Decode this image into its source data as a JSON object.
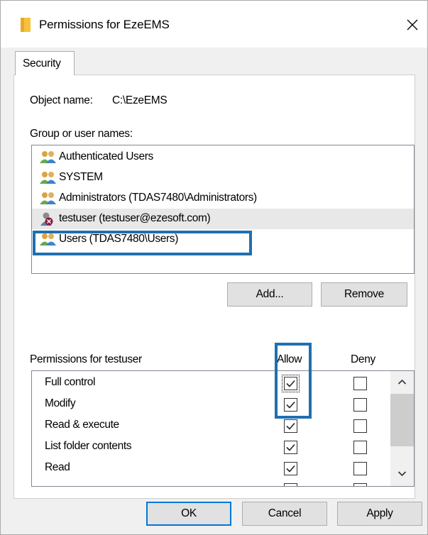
{
  "window": {
    "title": "Permissions for EzeEMS",
    "icons": {
      "app": "folder-icon",
      "close": "close-icon"
    }
  },
  "tabs": [
    {
      "label": "Security",
      "active": true
    }
  ],
  "object": {
    "label": "Object name:",
    "value": "C:\\EzeEMS"
  },
  "groups": {
    "label": "Group or user names:",
    "items": [
      {
        "name": "Authenticated Users",
        "icon": "user-group-icon",
        "selected": false
      },
      {
        "name": "SYSTEM",
        "icon": "user-group-icon",
        "selected": false
      },
      {
        "name": "Administrators (TDAS7480\\Administrators)",
        "icon": "user-group-icon",
        "selected": false
      },
      {
        "name": "testuser (testuser@ezesoft.com)",
        "icon": "unknown-user-icon",
        "selected": true
      },
      {
        "name": "Users (TDAS7480\\Users)",
        "icon": "user-group-icon",
        "selected": false
      }
    ],
    "add_label": "Add...",
    "remove_label": "Remove"
  },
  "permissions": {
    "label": "Permissions for testuser",
    "allow_label": "Allow",
    "deny_label": "Deny",
    "items": [
      {
        "name": "Full control",
        "allow": true,
        "deny": false
      },
      {
        "name": "Modify",
        "allow": true,
        "deny": false
      },
      {
        "name": "Read & execute",
        "allow": true,
        "deny": false
      },
      {
        "name": "List folder contents",
        "allow": true,
        "deny": false
      },
      {
        "name": "Read",
        "allow": true,
        "deny": false
      }
    ]
  },
  "buttons": {
    "ok": "OK",
    "cancel": "Cancel",
    "apply": "Apply"
  },
  "colors": {
    "highlight": "#1f6fb0",
    "default_button_border": "#0078d7",
    "dialog_bg": "#f0f0f0"
  }
}
